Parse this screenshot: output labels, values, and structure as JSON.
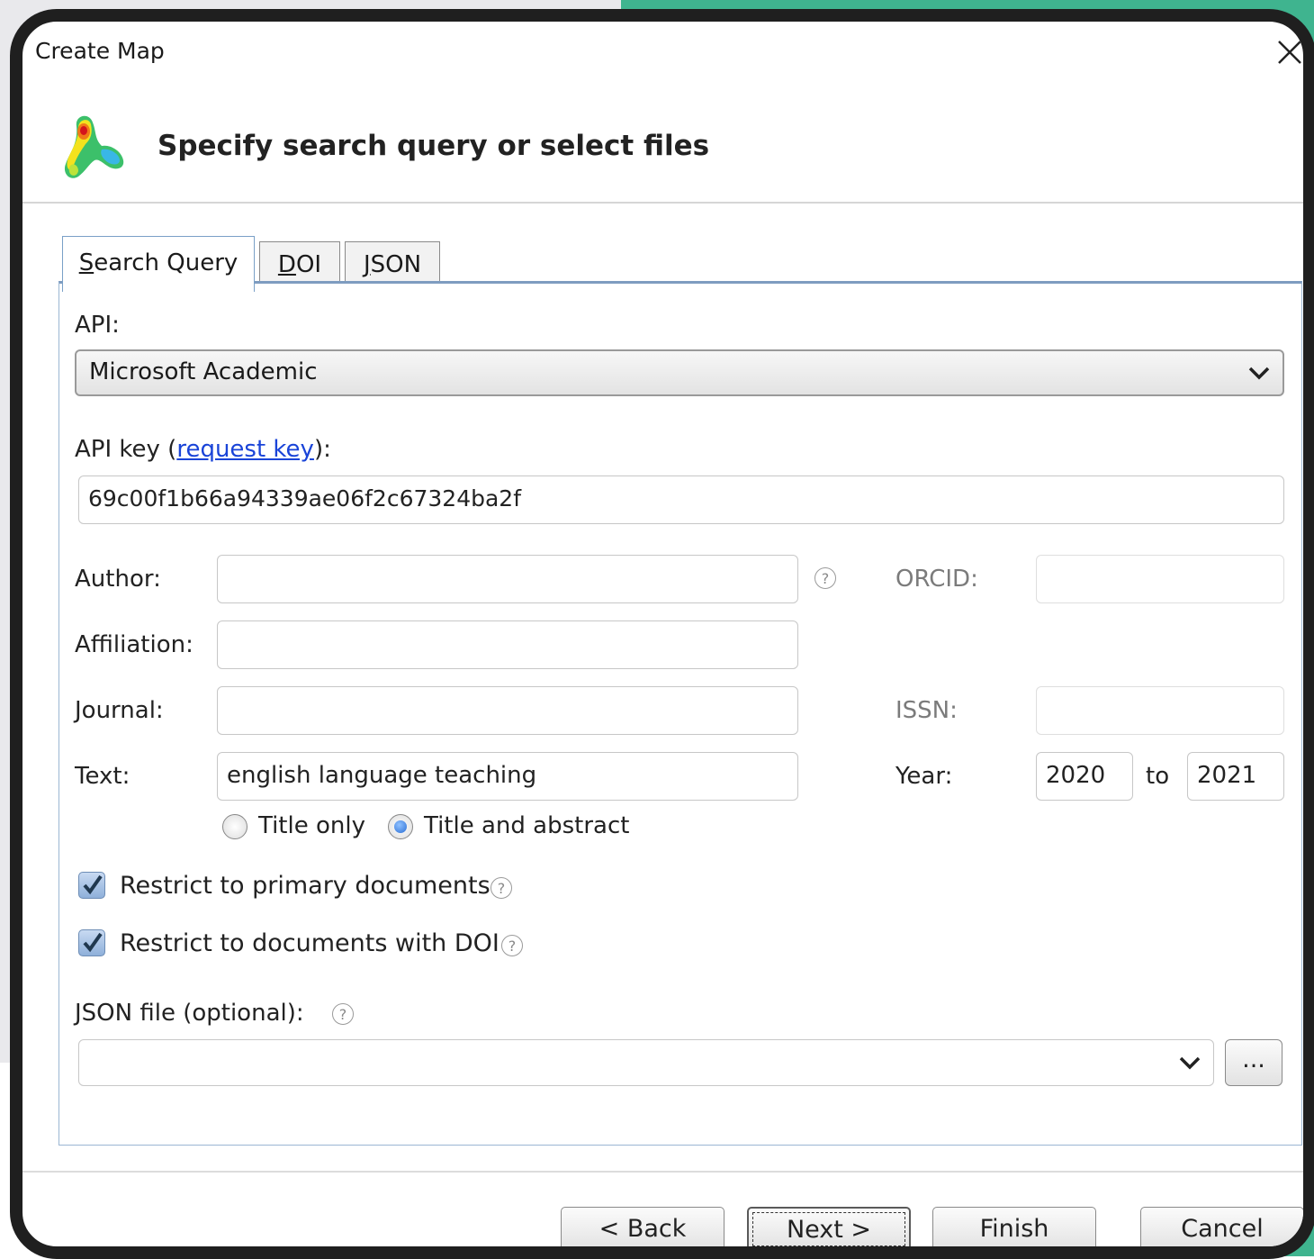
{
  "window": {
    "title": "Create Map",
    "heading": "Specify search query or select files"
  },
  "tabs": [
    {
      "label": "Search Query",
      "accesskey": "S",
      "rest": "earch Query"
    },
    {
      "label": "DOI",
      "accesskey": "D",
      "rest": "OI"
    },
    {
      "label": "JSON",
      "accesskey": "J",
      "rest": "SON"
    }
  ],
  "api": {
    "label": "API:",
    "selected": "Microsoft Academic"
  },
  "api_key": {
    "label_prefix": "API key (",
    "link": "request key",
    "label_suffix": "):",
    "value": "69c00f1b66a94339ae06f2c67324ba2f"
  },
  "fields": {
    "author_label": "Author:",
    "author_value": "",
    "orcid_label": "ORCID:",
    "orcid_value": "",
    "affiliation_label": "Affiliation:",
    "affiliation_value": "",
    "journal_label": "Journal:",
    "journal_value": "",
    "issn_label": "ISSN:",
    "issn_value": "",
    "text_label": "Text:",
    "text_value": "english language teaching",
    "year_label": "Year:",
    "year_from": "2020",
    "year_to_label": "to",
    "year_to": "2021"
  },
  "text_scope": {
    "title_only": "Title only",
    "title_and_abstract": "Title and abstract",
    "selected": "title_and_abstract"
  },
  "checkboxes": {
    "primary": {
      "label": "Restrict to primary documents",
      "checked": true
    },
    "doi": {
      "label": "Restrict to documents with DOI",
      "checked": true
    }
  },
  "json_file": {
    "label": "JSON file (optional):",
    "value": "",
    "browse": "..."
  },
  "help_glyph": "?",
  "buttons": {
    "back": "< Back",
    "next": "Next >",
    "finish": "Finish",
    "cancel": "Cancel"
  },
  "icons": {
    "close": "close-icon",
    "logo": "vosviewer-density-icon",
    "dropdown": "chevron-down-icon",
    "help": "help-icon"
  }
}
